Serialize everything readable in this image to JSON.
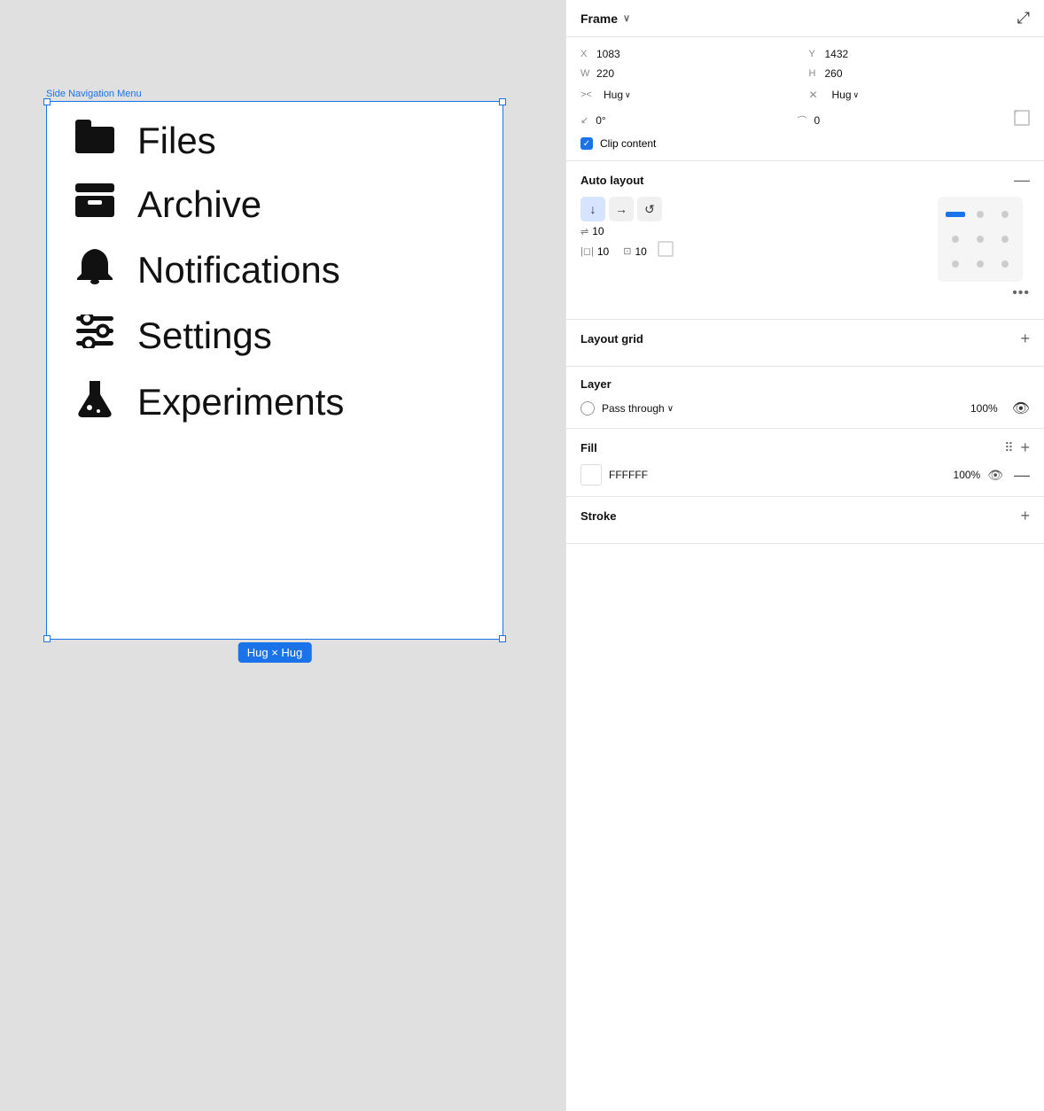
{
  "canvas": {
    "frame_label": "Side Navigation Menu",
    "hug_badge": "Hug × Hug",
    "nav_items": [
      {
        "icon": "📁",
        "label": "Files"
      },
      {
        "icon": "🗄",
        "label": "Archive"
      },
      {
        "icon": "🔔",
        "label": "Notifications"
      },
      {
        "icon": "⇅",
        "label": "Settings"
      },
      {
        "icon": "🧪",
        "label": "Experiments"
      }
    ]
  },
  "panel": {
    "header": {
      "title": "Frame",
      "collapse_icon": "⤢"
    },
    "position": {
      "x_label": "X",
      "x_value": "1083",
      "y_label": "Y",
      "y_value": "1432",
      "w_label": "W",
      "w_value": "220",
      "h_label": "H",
      "h_value": "260"
    },
    "hug": {
      "hx_label": "><",
      "hx_value": "Hug",
      "hy_label": "✕",
      "hy_value": "Hug"
    },
    "angle": {
      "label": "0°",
      "radius_label": "0"
    },
    "clip_content": "Clip content",
    "auto_layout": {
      "title": "Auto layout",
      "spacing_gap": "10",
      "padding_left": "10",
      "padding_right": "10"
    },
    "layout_grid": {
      "title": "Layout grid",
      "add_label": "+"
    },
    "layer": {
      "title": "Layer",
      "mode": "Pass through",
      "opacity": "100%"
    },
    "fill": {
      "title": "Fill",
      "hex": "FFFFFF",
      "opacity": "100%"
    },
    "stroke": {
      "title": "Stroke",
      "add_label": "+"
    }
  }
}
